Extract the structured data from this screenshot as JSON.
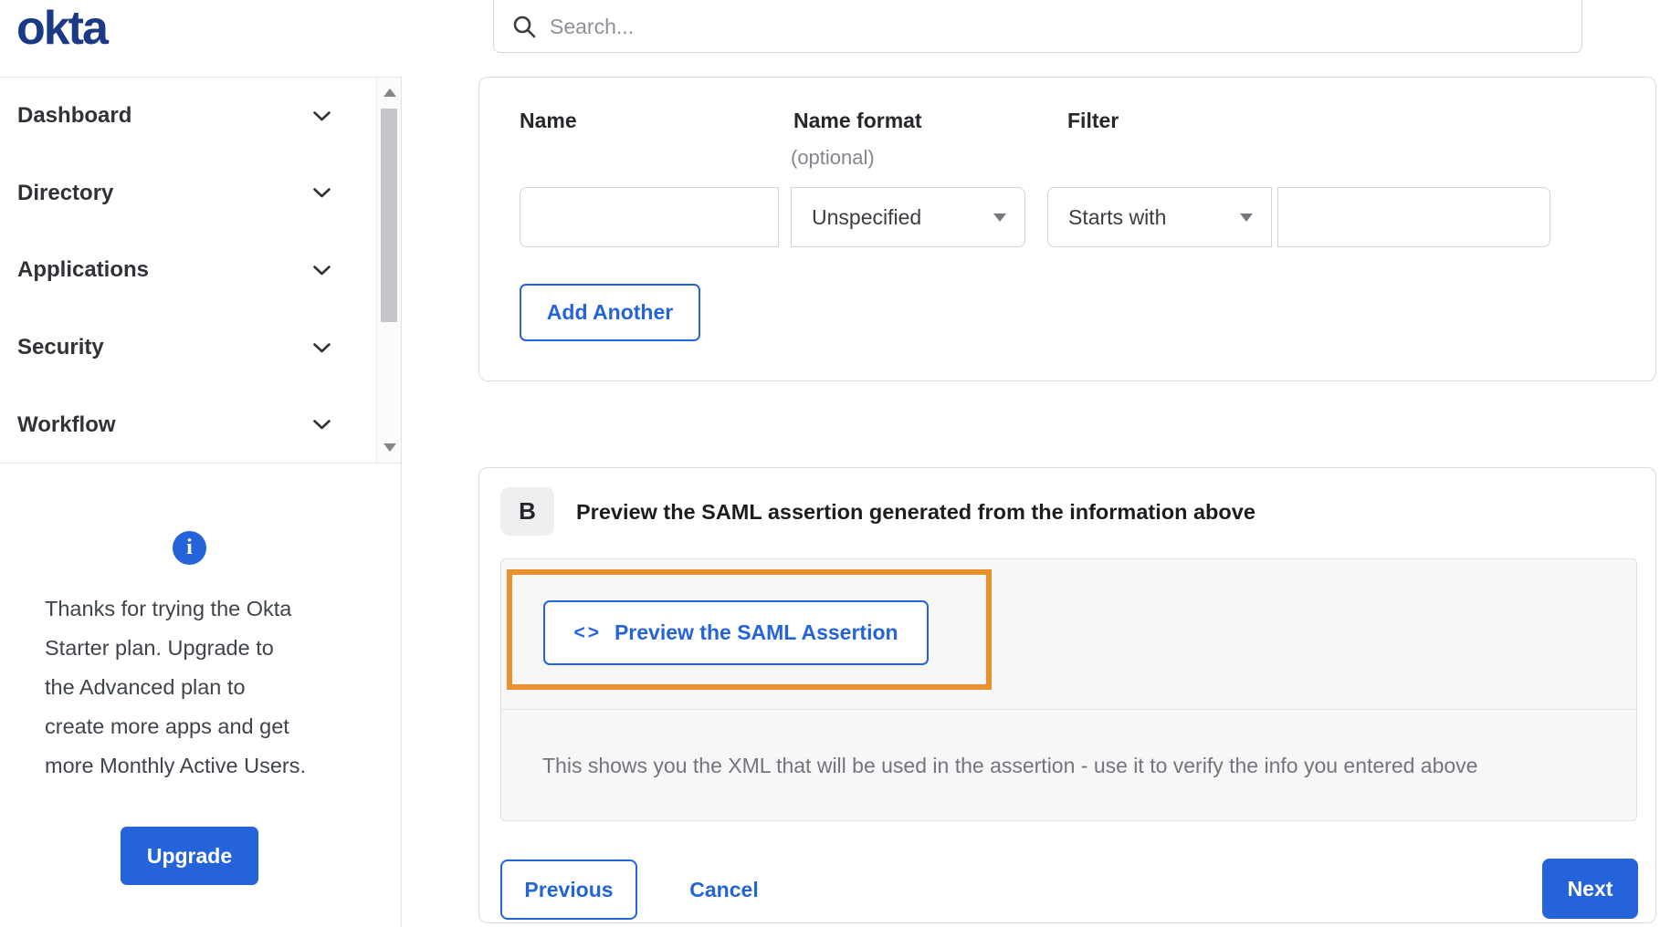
{
  "header": {
    "logo": "okta",
    "search": {
      "placeholder": "Search...",
      "value": ""
    }
  },
  "sidebar": {
    "items": [
      {
        "label": "Dashboard"
      },
      {
        "label": "Directory"
      },
      {
        "label": "Applications"
      },
      {
        "label": "Security"
      },
      {
        "label": "Workflow"
      }
    ]
  },
  "upsell": {
    "lines": [
      "Thanks for trying the Okta",
      "Starter plan. Upgrade to",
      "the Advanced plan to",
      "create more apps and get",
      "more Monthly Active Users."
    ],
    "button_label": "Upgrade",
    "info_icon_glyph": "i"
  },
  "attribute_form": {
    "name_label": "Name",
    "name_format_label": "Name format",
    "name_format_hint": "(optional)",
    "filter_label": "Filter",
    "name_value": "",
    "name_format_value": "Unspecified",
    "filter_operator_value": "Starts with",
    "filter_value": "",
    "add_another_label": "Add Another"
  },
  "preview_section": {
    "step_badge": "B",
    "heading": "Preview the SAML assertion generated from the information above",
    "preview_button": {
      "icon": "<>",
      "label": "Preview the SAML Assertion"
    },
    "description": "This shows you the XML that will be used in the assertion - use it to verify the info you entered above"
  },
  "footer": {
    "previous_label": "Previous",
    "cancel_label": "Cancel",
    "next_label": "Next"
  },
  "colors": {
    "accent_blue": "#2563db",
    "logo_navy": "#1b3a85",
    "annotation_orange": "#e8912d",
    "panel_gray": "#f7f7f8",
    "text_dark": "#26262b",
    "text_gray": "#74747e"
  }
}
